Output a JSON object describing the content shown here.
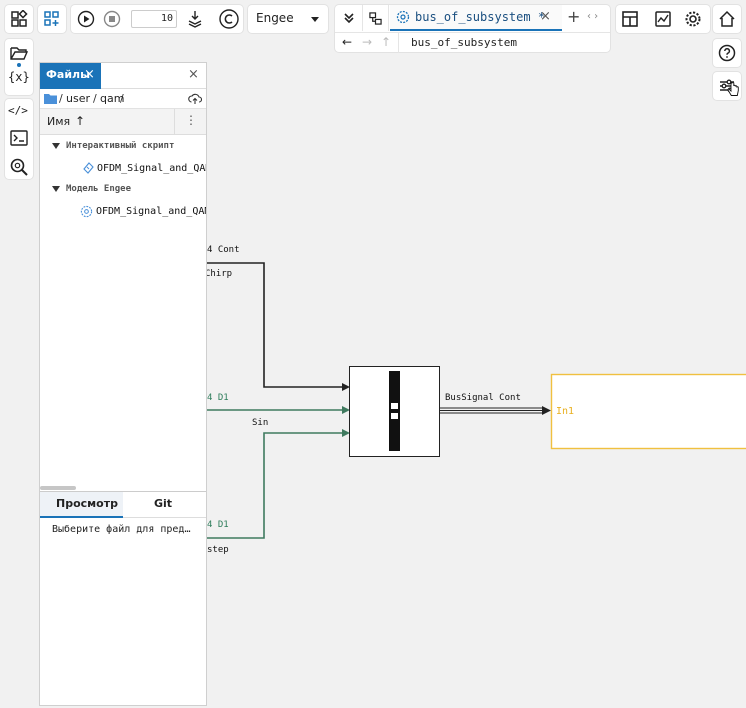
{
  "toolbar": {
    "step_value": "10",
    "env_select": "Engee",
    "tab_title": "bus_of_subsystem *",
    "breadcrumb": "bus_of_subsystem"
  },
  "file_panel": {
    "tab_files": "Файлы",
    "path": [
      "user",
      "qam"
    ],
    "sep": "/",
    "column_name": "Имя",
    "sort_arrow": "↑",
    "groups": [
      {
        "label": "Интерактивный скрипт",
        "file": "OFDM_Signal_and_QAM"
      },
      {
        "label": "Модель Engee",
        "file": "OFDM_Signal_and_QAM"
      }
    ],
    "bottom_tabs": [
      "Просмотр",
      "Git"
    ],
    "preview_text": "Выберите файл для предпросмотра"
  },
  "canvas": {
    "labels": {
      "cont_top": "4 Cont",
      "chirp": "Chirp",
      "d1_mid": "4 D1",
      "sin": "Sin",
      "d1_bottom": "4 D1",
      "step": "step",
      "bus_signal": "BusSignal Cont",
      "in1": "In1"
    }
  },
  "colors": {
    "accent": "#1a73b8",
    "green_wire": "#3f7a5f",
    "port_yellow": "#f0c040"
  }
}
